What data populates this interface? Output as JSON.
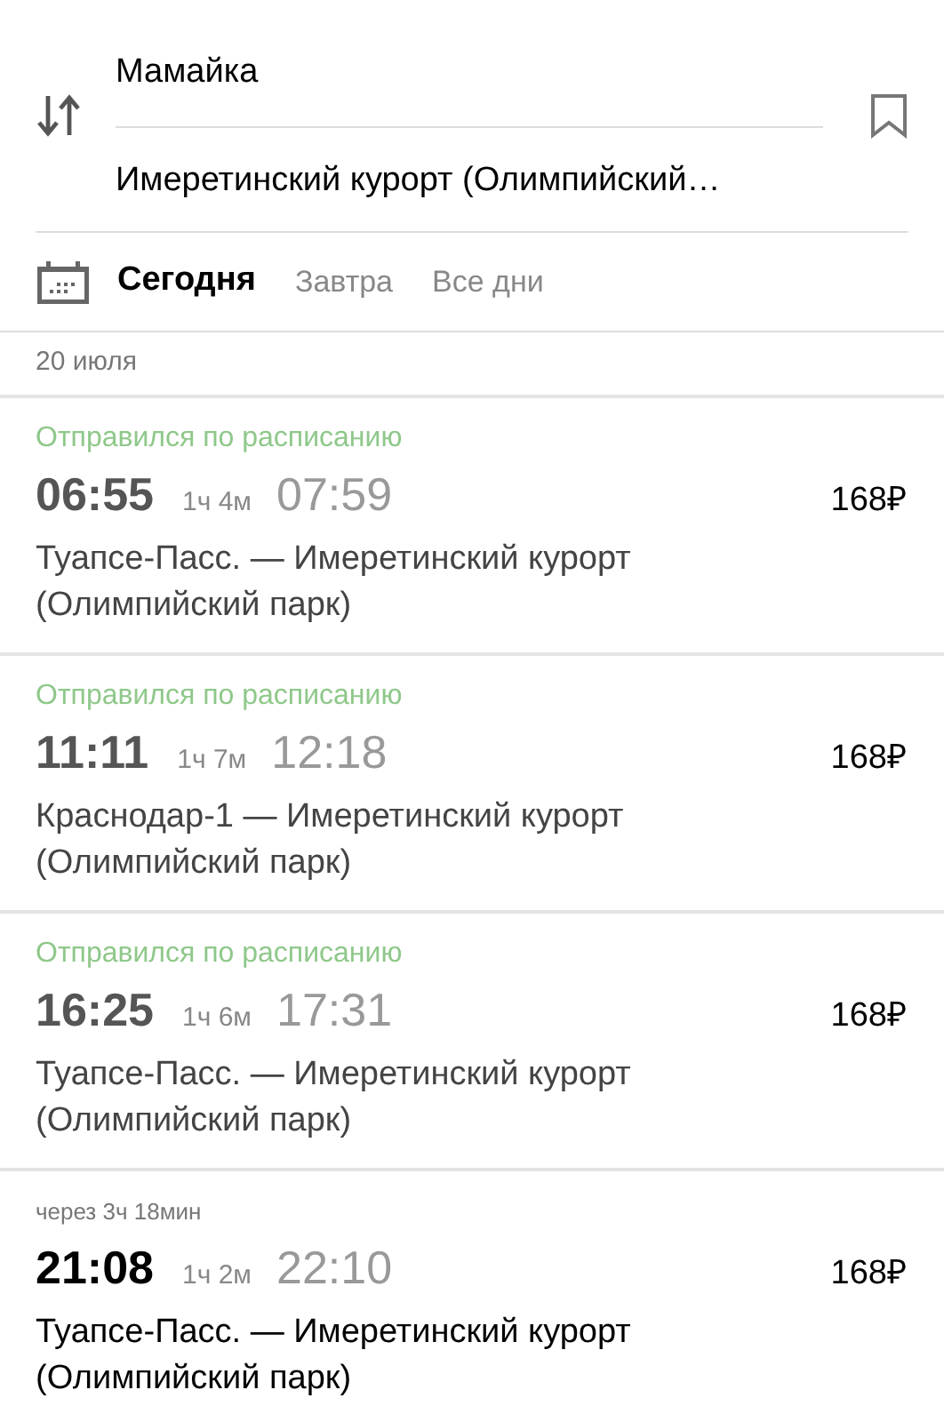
{
  "route": {
    "from": "Мамайка",
    "to": "Имеретинский курорт (Олимпийский…"
  },
  "date_tabs": [
    {
      "label": "Сегодня",
      "selected": true
    },
    {
      "label": "Завтра",
      "selected": false
    },
    {
      "label": "Все дни",
      "selected": false
    }
  ],
  "date_header": "20 июля",
  "trips": [
    {
      "status": "Отправился по расписанию",
      "departed": true,
      "departure": "06:55",
      "duration": "1ч 4м",
      "arrival": "07:59",
      "price": "168₽",
      "route": "Туапсе-Пасс. — Имеретинский курорт (Олимпийский парк)"
    },
    {
      "status": "Отправился по расписанию",
      "departed": true,
      "departure": "11:11",
      "duration": "1ч 7м",
      "arrival": "12:18",
      "price": "168₽",
      "route": "Краснодар-1 — Имеретинский курорт (Олимпийский парк)"
    },
    {
      "status": "Отправился по расписанию",
      "departed": true,
      "departure": "16:25",
      "duration": "1ч 6м",
      "arrival": "17:31",
      "price": "168₽",
      "route": "Туапсе-Пасс. — Имеретинский курорт (Олимпийский парк)"
    },
    {
      "status": "через 3ч 18мин",
      "departed": false,
      "departure": "21:08",
      "duration": "1ч 2м",
      "arrival": "22:10",
      "price": "168₽",
      "route": "Туапсе-Пасс. — Имеретинский курорт (Олимпийский парк)"
    }
  ]
}
